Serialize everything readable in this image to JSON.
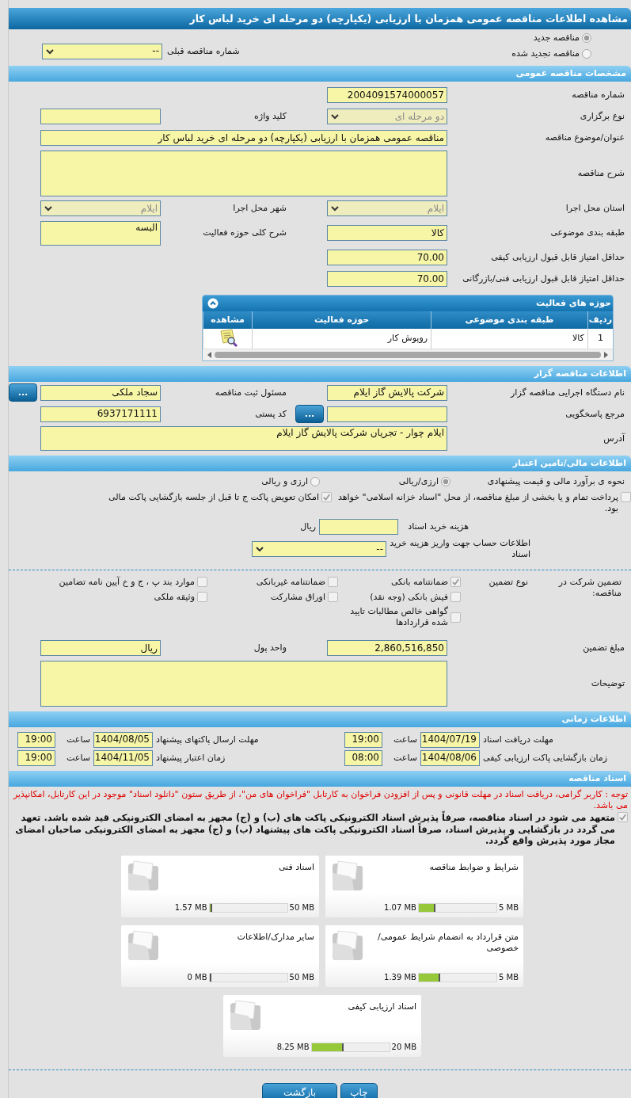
{
  "title": "مشاهده اطلاعات مناقصه عمومی همزمان با ارزیابی (یکپارچه) دو مرحله ای خرید لباس کار",
  "tender_type": [
    {
      "label": "مناقصه جدید",
      "selected": true
    },
    {
      "label": "مناقصه تجدید شده",
      "selected": false
    }
  ],
  "previous_tender": {
    "label": "شماره مناقصه قبلی",
    "value": "--",
    "disabled": false
  },
  "general": {
    "title": "مشخصات مناقصه عمومی",
    "rows": [
      [
        {
          "label": "شماره مناقصه",
          "value": "2004091574000057",
          "kind": "text"
        }
      ],
      [
        {
          "label": "نوع برگزاری",
          "value": "دو مرحله ای",
          "kind": "select",
          "disabled": true
        },
        {
          "label": "کلید واژه",
          "kind": "text"
        }
      ],
      [
        {
          "label": "عنوان/موضوع مناقصه",
          "value": "مناقصه عمومی همزمان با ارزیابی (یکپارچه) دو مرحله ای خرید لباس کار",
          "kind": "wide"
        }
      ],
      [
        {
          "label": "شرح مناقصه",
          "kind": "area"
        }
      ],
      [
        {
          "label": "استان محل اجرا",
          "value": "ایلام",
          "kind": "select",
          "disabled": true
        },
        {
          "label": "شهر محل اجرا",
          "value": "ایلام",
          "kind": "select",
          "disabled": true
        }
      ],
      [
        {
          "label": "طبقه بندی موضوعی",
          "value": "کالا",
          "kind": "text"
        },
        {
          "label": "شرح کلی حوزه فعالیت",
          "value": "البسه",
          "kind": "memo"
        }
      ],
      [
        {
          "label": "حداقل امتیاز قابل قبول ارزیابی کیفی",
          "value": "70.00",
          "kind": "text"
        }
      ],
      [
        {
          "label": "حداقل امتیاز قابل قبول ارزیابی فنی/بازرگانی",
          "value": "70.00",
          "kind": "text"
        }
      ]
    ],
    "activities": {
      "title": "حوزه های فعالیت",
      "columns": [
        "ردیف",
        "طبقه بندی موضوعی",
        "حوزه فعالیت",
        "مشاهده"
      ],
      "rows": [
        [
          "1",
          "کالا",
          "روپوش کار"
        ]
      ]
    }
  },
  "owner": {
    "title": "اطلاعات مناقصه گزار",
    "rows": [
      [
        {
          "label": "نام دستگاه اجرایی مناقصه گزار",
          "value": "شرکت پالایش گاز ایلام",
          "kind": "text"
        },
        {
          "label": "مسئول ثبت مناقصه",
          "value": "سجاد ملکی",
          "kind": "text",
          "button": "..."
        }
      ],
      [
        {
          "label": "مرجع پاسخگویی",
          "kind": "text",
          "button": "..."
        },
        {
          "label": "کد پستی",
          "value": "6937171111",
          "kind": "text"
        }
      ],
      [
        {
          "label": "آدرس",
          "value": "ایلام چوار - تجریان شرکت پالایش گاز ایلام",
          "kind": "wide_memo"
        }
      ]
    ]
  },
  "finance": {
    "title": "اطلاعات مالی/تامین اعتبار",
    "estimate": {
      "label": "نحوه ی برآورد مالی و قیمت پیشنهادی",
      "options": [
        {
          "label": "ارزی/ریالی",
          "selected": true
        },
        {
          "label": "ارزی و ریالی",
          "selected": false
        }
      ]
    },
    "options": [
      {
        "label": "پرداخت تمام و یا بخشی از مبلغ مناقصه، از محل \"اسناد خزانه اسلامی\" خواهد بود.",
        "checked": false
      },
      {
        "label": "امکان تعویض پاکت ج تا قبل از جلسه بازگشایی پاکت مالی",
        "checked": true
      }
    ],
    "doc_fee": {
      "label": "هزینه خرید اسناد",
      "unit": "ریال"
    },
    "account": {
      "label": "اطلاعات حساب جهت واریز هزینه خرید اسناد",
      "value": "--",
      "disabled": false
    },
    "guarantee": {
      "label": "تضمین شرکت در مناقصه:",
      "type_label": "نوع تضمین",
      "types": [
        {
          "label": "ضمانتنامه بانکی",
          "checked": true
        },
        {
          "label": "ضمانتنامه غیربانکی",
          "checked": false
        },
        {
          "label": "موارد بند پ ، ج و خ آیین نامه تضامین",
          "checked": false
        },
        {
          "label": "فیش بانکی (وجه نقد)",
          "checked": false
        },
        {
          "label": "اوراق مشارکت",
          "checked": false
        },
        {
          "label": "وثیقه ملکی",
          "checked": false
        },
        {
          "label": "گواهی خالص مطالبات تایید شده قراردادها",
          "checked": false
        }
      ]
    },
    "rows": [
      [
        {
          "label": "مبلغ تضمین",
          "value": "2,860,516,850",
          "kind": "text"
        },
        {
          "label": "واحد پول",
          "value": "ریال",
          "kind": "text"
        }
      ],
      [
        {
          "label": "توضیحات",
          "kind": "area"
        }
      ]
    ]
  },
  "schedule": {
    "title": "اطلاعات زمانی",
    "items": [
      {
        "label": "مهلت دریافت اسناد",
        "date": "1404/07/19",
        "hour_label": "ساعت",
        "time": "19:00"
      },
      {
        "label": "مهلت ارسال پاکتهای پیشنهاد",
        "date": "1404/08/05",
        "hour_label": "ساعت",
        "time": "19:00"
      },
      {
        "label": "زمان بازگشایی پاکت ارزیابی کیفی",
        "date": "1404/08/06",
        "hour_label": "ساعت",
        "time": "08:00"
      },
      {
        "label": "زمان اعتبار پیشنهاد",
        "date": "1404/11/05",
        "hour_label": "ساعت",
        "time": "19:00"
      }
    ]
  },
  "documents": {
    "title": "اسناد مناقصه",
    "notice": "توجه : کاربر گرامی، دریافت اسناد در مهلت قانونی و پس از افزودن فراخوان به کارتابل \"فراخوان های من\"، از طریق ستون \"دانلود اسناد\" موجود در این کارتابل، امکانپذیر می باشد.",
    "pledge": {
      "text": "متعهد می شود در اسناد مناقصه، صرفاً پذیرش اسناد الکترونیکی پاکت های (ب) و (ج) مجهز به امضای الکترونیکی قید شده باشد. تعهد می گردد در بازگشایی و پذیرش اسناد، صرفاً اسناد الکترونیکی پاکت های پیشنهاد (ب) و (ج) مجهز به امضای الکترونیکی صاحبان امضای مجاز مورد پذیرش واقع گردد.",
      "checked": true
    },
    "files": [
      {
        "name": "شرایط و ضوابط مناقصه",
        "used": "1.07 MB",
        "max": "5 MB",
        "level": 0.214
      },
      {
        "name": "اسناد فنی",
        "used": "1.57 MB",
        "max": "50 MB",
        "level": 0.031
      },
      {
        "name": "متن قرارداد به انضمام شرایط عمومی/خصوصی",
        "used": "1.39 MB",
        "max": "5 MB",
        "level": 0.278
      },
      {
        "name": "سایر مدارک/اطلاعات",
        "used": "0 MB",
        "max": "50 MB",
        "level": 0
      },
      {
        "name": "اسناد ارزیابی کیفی",
        "used": "8.25 MB",
        "max": "20 MB",
        "level": 0.4125
      }
    ]
  },
  "buttons": [
    "چاپ",
    "بازگشت"
  ]
}
